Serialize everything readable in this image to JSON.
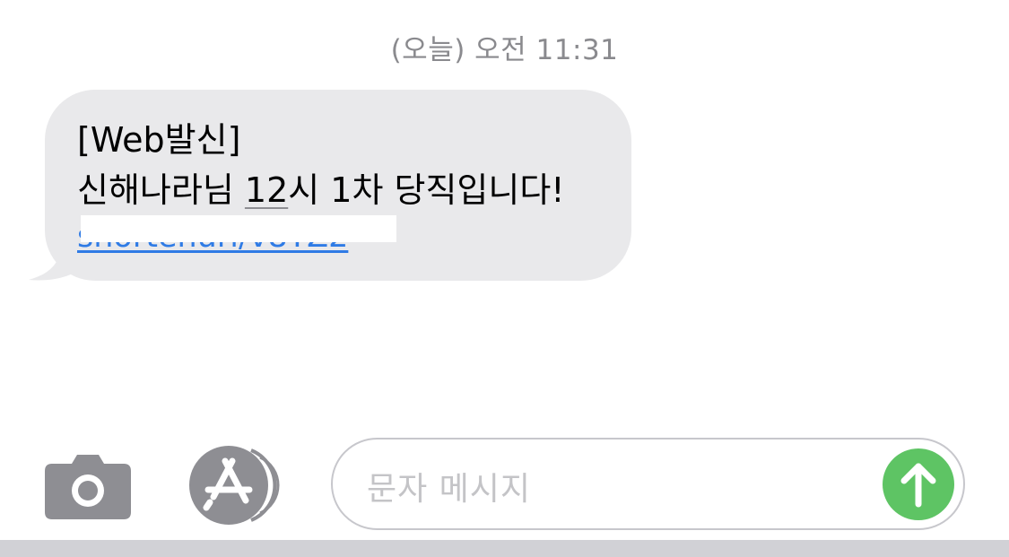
{
  "header": {
    "timestamp": "(오늘) 오전 11:31"
  },
  "message": {
    "line1": "[Web발신]",
    "line2_prefix": "신해나라님 ",
    "line2_number": "12",
    "line2_suffix": "시 1차 당직입니다!",
    "link_text": "shortenurl/v8YZ2"
  },
  "composer": {
    "placeholder": "문자 메시지"
  },
  "icons": {
    "camera": "camera-icon",
    "appstore": "app-store-icon",
    "send": "arrow-up-icon"
  },
  "colors": {
    "bubble": "#e9e9eb",
    "link": "#2f7be5",
    "send": "#5ec464",
    "icon_gray": "#8e8e93"
  }
}
